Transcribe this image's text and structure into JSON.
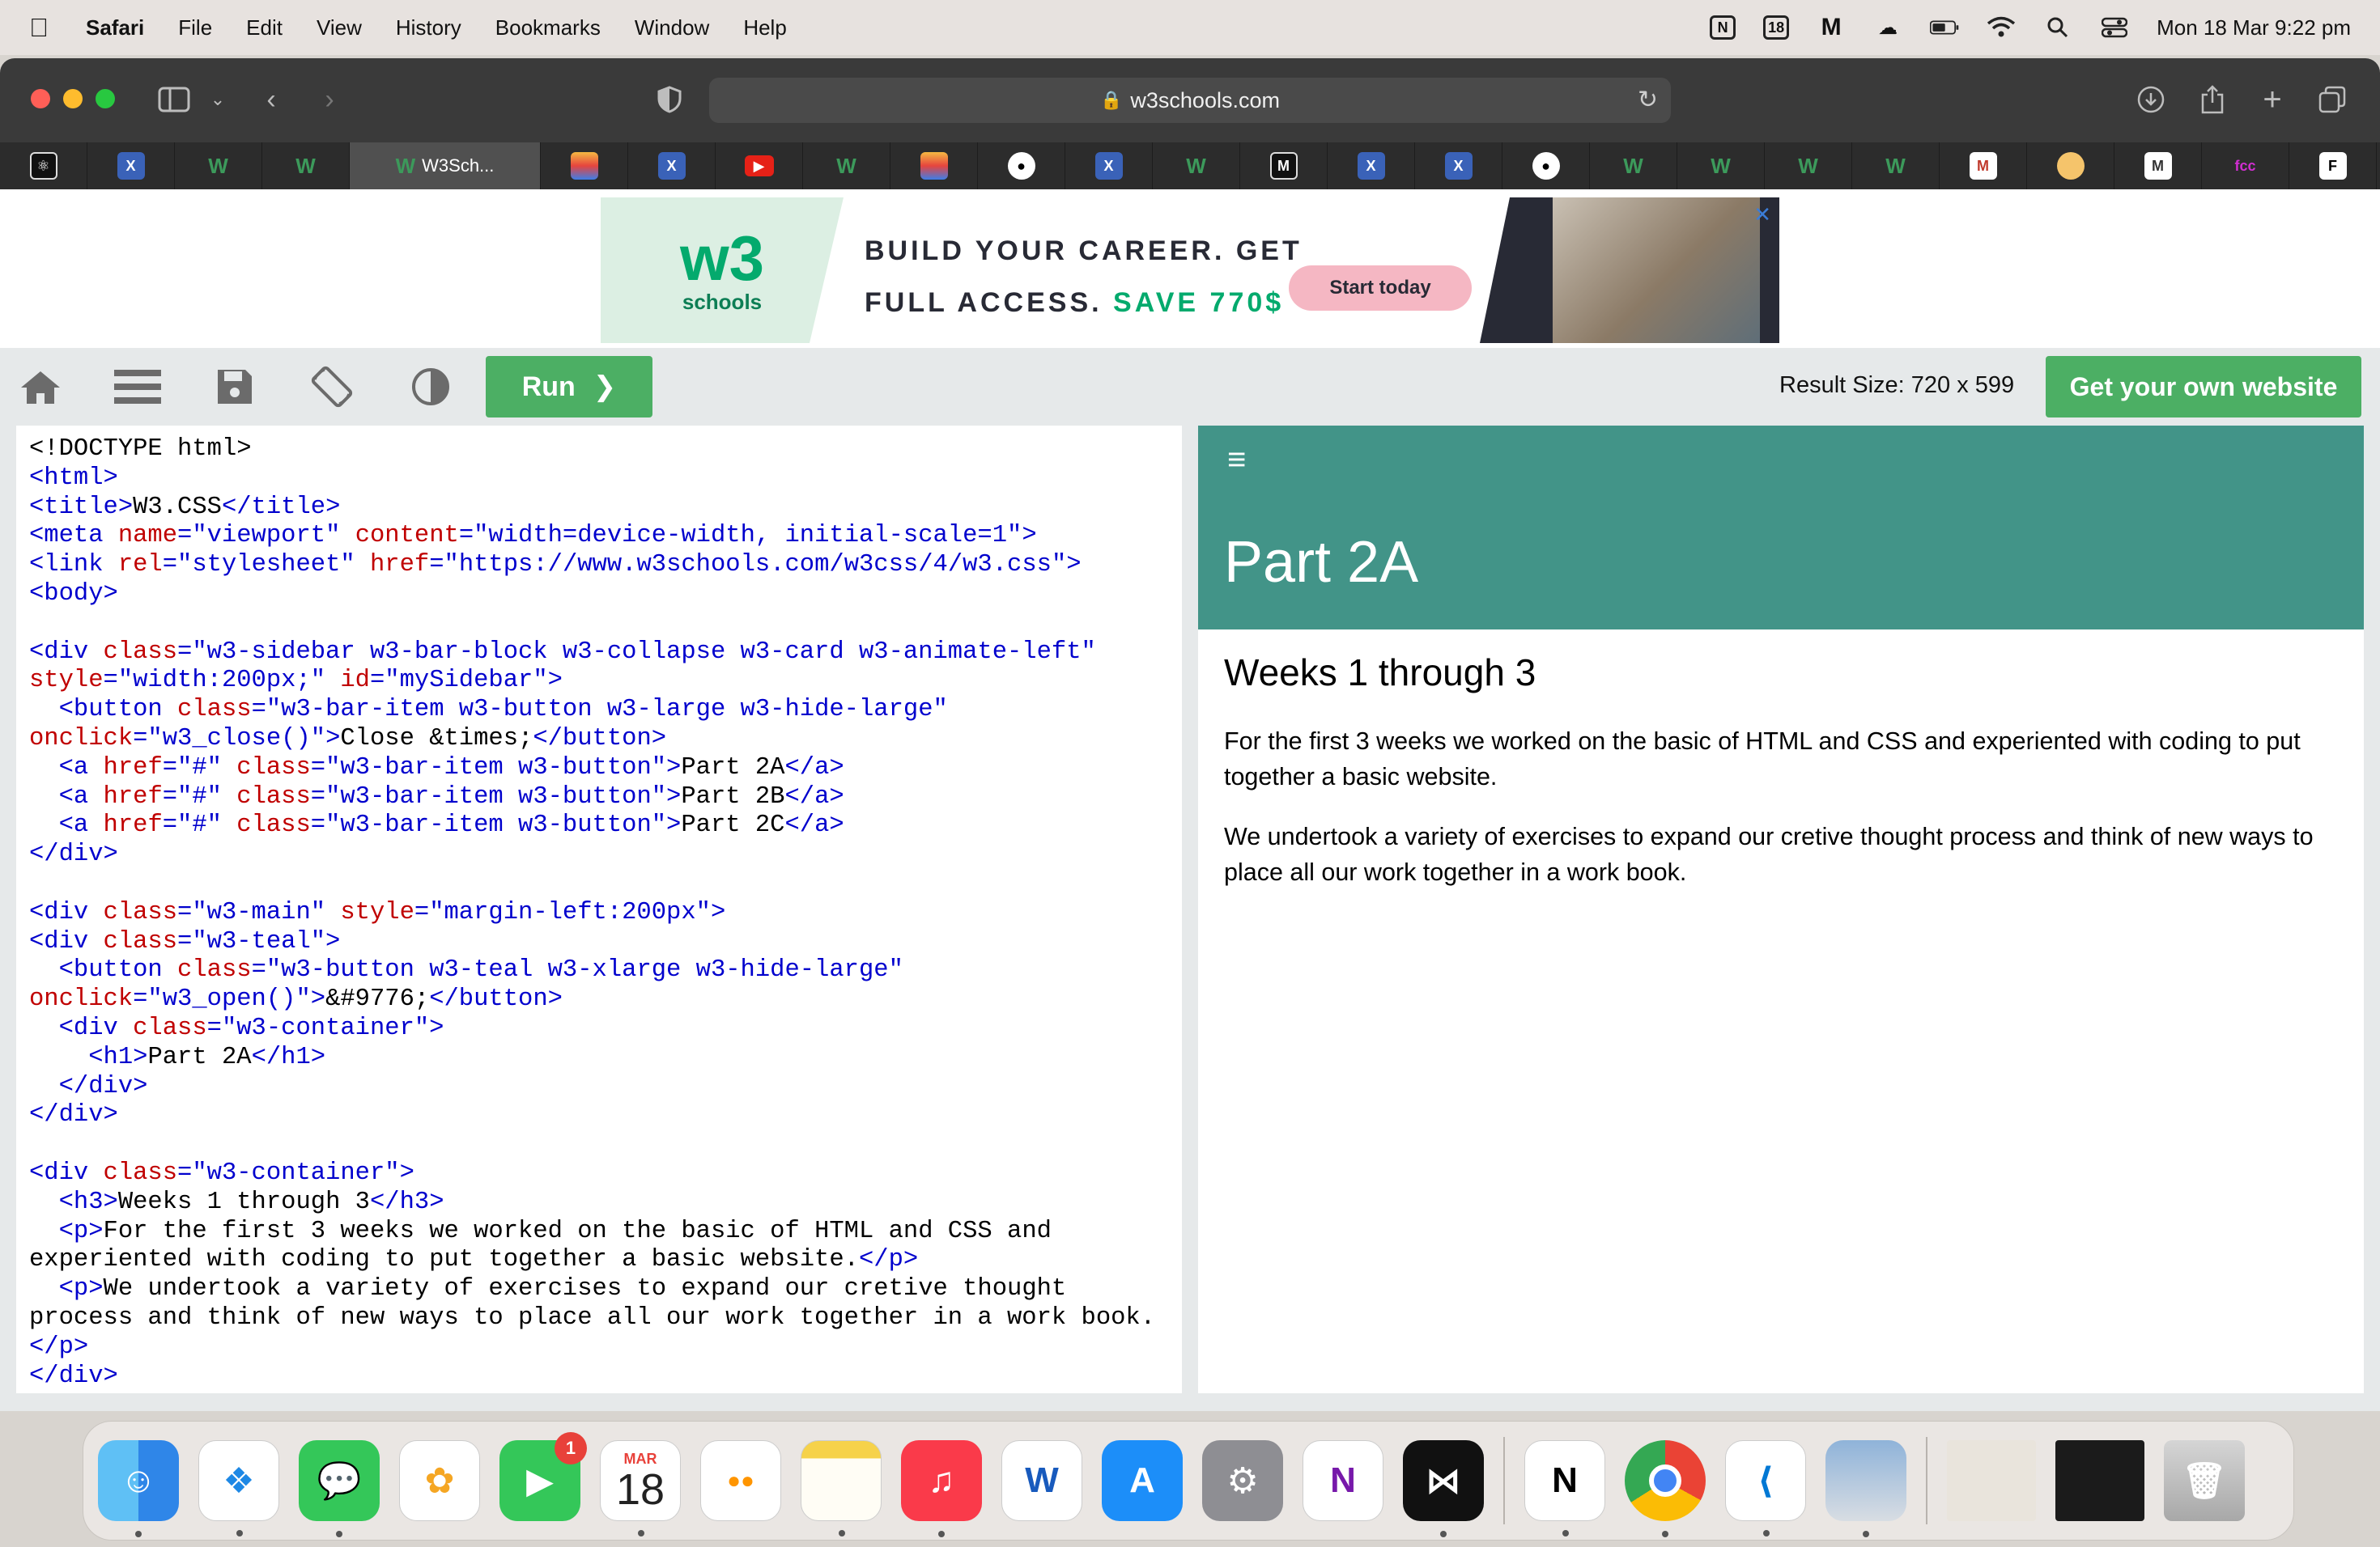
{
  "menubar": {
    "app_name": "Safari",
    "menus": [
      "File",
      "Edit",
      "View",
      "History",
      "Bookmarks",
      "Window",
      "Help"
    ],
    "status_badge_18": "18",
    "datetime": "Mon 18 Mar  9:22 pm"
  },
  "browser": {
    "url": "w3schools.com",
    "active_tab_label": "W3Sch...",
    "tab_icons": [
      "atom-icon",
      "w3schools-badge-icon",
      "w3-icon",
      "w3-icon",
      "w3-icon-active",
      "photos-icon",
      "w3schools-badge-icon",
      "youtube-icon",
      "w3-icon",
      "photos-icon",
      "github-icon",
      "w3schools-badge-icon",
      "w3-icon",
      "miro-icon",
      "w3schools-badge-icon",
      "w3schools-badge-icon",
      "github-icon",
      "w3-icon",
      "w3-icon",
      "w3-icon",
      "w3-icon",
      "m-icon",
      "tidy-icon",
      "m-icon",
      "fcc-icon",
      "f-icon"
    ]
  },
  "ad": {
    "logo_w3": "w3",
    "logo_schools": "schools",
    "headline_line1": "BUILD YOUR CAREER. GET",
    "headline_line2_prefix": "FULL ACCESS.",
    "headline_line2_save": "SAVE 770$",
    "cta": "Start today"
  },
  "tryit": {
    "run_label": "Run",
    "result_size": "Result Size: 720 x 599",
    "own_website": "Get your own website"
  },
  "code_lines": [
    [
      [
        "t",
        "<!DOCTYPE html>"
      ]
    ],
    [
      [
        "g",
        "<html>"
      ]
    ],
    [
      [
        "g",
        "<title>"
      ],
      [
        "t",
        "W3.CSS"
      ],
      [
        "g",
        "</title>"
      ]
    ],
    [
      [
        "g",
        "<meta "
      ],
      [
        "a",
        "name"
      ],
      [
        "g",
        "=\"viewport\" "
      ],
      [
        "a",
        "content"
      ],
      [
        "g",
        "=\"width=device-width, initial-scale=1\">"
      ]
    ],
    [
      [
        "g",
        "<link "
      ],
      [
        "a",
        "rel"
      ],
      [
        "g",
        "=\"stylesheet\" "
      ],
      [
        "a",
        "href"
      ],
      [
        "g",
        "=\"https://www.w3schools.com/w3css/4/w3.css\">"
      ]
    ],
    [
      [
        "g",
        "<body>"
      ]
    ],
    [
      [
        "t",
        ""
      ]
    ],
    [
      [
        "g",
        "<div "
      ],
      [
        "a",
        "class"
      ],
      [
        "g",
        "=\"w3-sidebar w3-bar-block w3-collapse w3-card w3-animate-left\""
      ]
    ],
    [
      [
        "a",
        "style"
      ],
      [
        "g",
        "=\"width:200px;\" "
      ],
      [
        "a",
        "id"
      ],
      [
        "g",
        "=\"mySidebar\">"
      ]
    ],
    [
      [
        "t",
        "  "
      ],
      [
        "g",
        "<button "
      ],
      [
        "a",
        "class"
      ],
      [
        "g",
        "=\"w3-bar-item w3-button w3-large w3-hide-large\""
      ]
    ],
    [
      [
        "a",
        "onclick"
      ],
      [
        "g",
        "=\"w3_close()\">"
      ],
      [
        "t",
        "Close &times;"
      ],
      [
        "g",
        "</button>"
      ]
    ],
    [
      [
        "t",
        "  "
      ],
      [
        "g",
        "<a "
      ],
      [
        "a",
        "href"
      ],
      [
        "g",
        "=\"#\" "
      ],
      [
        "a",
        "class"
      ],
      [
        "g",
        "=\"w3-bar-item w3-button\">"
      ],
      [
        "t",
        "Part 2A"
      ],
      [
        "g",
        "</a>"
      ]
    ],
    [
      [
        "t",
        "  "
      ],
      [
        "g",
        "<a "
      ],
      [
        "a",
        "href"
      ],
      [
        "g",
        "=\"#\" "
      ],
      [
        "a",
        "class"
      ],
      [
        "g",
        "=\"w3-bar-item w3-button\">"
      ],
      [
        "t",
        "Part 2B"
      ],
      [
        "g",
        "</a>"
      ]
    ],
    [
      [
        "t",
        "  "
      ],
      [
        "g",
        "<a "
      ],
      [
        "a",
        "href"
      ],
      [
        "g",
        "=\"#\" "
      ],
      [
        "a",
        "class"
      ],
      [
        "g",
        "=\"w3-bar-item w3-button\">"
      ],
      [
        "t",
        "Part 2C"
      ],
      [
        "g",
        "</a>"
      ]
    ],
    [
      [
        "g",
        "</div>"
      ]
    ],
    [
      [
        "t",
        ""
      ]
    ],
    [
      [
        "g",
        "<div "
      ],
      [
        "a",
        "class"
      ],
      [
        "g",
        "=\"w3-main\" "
      ],
      [
        "a",
        "style"
      ],
      [
        "g",
        "=\"margin-left:200px\">"
      ]
    ],
    [
      [
        "g",
        "<div "
      ],
      [
        "a",
        "class"
      ],
      [
        "g",
        "=\"w3-teal\">"
      ]
    ],
    [
      [
        "t",
        "  "
      ],
      [
        "g",
        "<button "
      ],
      [
        "a",
        "class"
      ],
      [
        "g",
        "=\"w3-button w3-teal w3-xlarge w3-hide-large\""
      ]
    ],
    [
      [
        "a",
        "onclick"
      ],
      [
        "g",
        "=\"w3_open()\">"
      ],
      [
        "t",
        "&#9776;"
      ],
      [
        "g",
        "</button>"
      ]
    ],
    [
      [
        "t",
        "  "
      ],
      [
        "g",
        "<div "
      ],
      [
        "a",
        "class"
      ],
      [
        "g",
        "=\"w3-container\">"
      ]
    ],
    [
      [
        "t",
        "    "
      ],
      [
        "g",
        "<h1>"
      ],
      [
        "t",
        "Part 2A"
      ],
      [
        "g",
        "</h1>"
      ]
    ],
    [
      [
        "t",
        "  "
      ],
      [
        "g",
        "</div>"
      ]
    ],
    [
      [
        "g",
        "</div>"
      ]
    ],
    [
      [
        "t",
        ""
      ]
    ],
    [
      [
        "g",
        "<div "
      ],
      [
        "a",
        "class"
      ],
      [
        "g",
        "=\"w3-container\">"
      ]
    ],
    [
      [
        "t",
        "  "
      ],
      [
        "g",
        "<h3>"
      ],
      [
        "t",
        "Weeks 1 through 3"
      ],
      [
        "g",
        "</h3>"
      ]
    ],
    [
      [
        "t",
        "  "
      ],
      [
        "g",
        "<p>"
      ],
      [
        "t",
        "For the first 3 weeks we worked on the basic of HTML and CSS and"
      ]
    ],
    [
      [
        "t",
        "experiented with coding to put together a basic website."
      ],
      [
        "g",
        "</p>"
      ]
    ],
    [
      [
        "t",
        "  "
      ],
      [
        "g",
        "<p>"
      ],
      [
        "t",
        "We undertook a variety of exercises to expand our cretive thought"
      ]
    ],
    [
      [
        "t",
        "process and think of new ways to place all our work together in a work book."
      ]
    ],
    [
      [
        "g",
        "</p>"
      ]
    ],
    [
      [
        "g",
        "</div>"
      ]
    ]
  ],
  "result": {
    "menu_glyph": "≡",
    "h1": "Part 2A",
    "h3": "Weeks 1 through 3",
    "p1": "For the first 3 weeks we worked on the basic of HTML and CSS and experiented with coding to put together a basic website.",
    "p2": "We undertook a variety of exercises to expand our cretive thought process and think of new ways to place all our work together in a work book."
  },
  "dock": {
    "calendar_month": "MAR",
    "calendar_day": "18",
    "facetime_badge": "1",
    "apps": [
      "finder",
      "safari",
      "messages",
      "photos",
      "facetime",
      "calendar",
      "reminders",
      "notes",
      "music",
      "word",
      "app-store",
      "system-settings",
      "onenote",
      "tidy",
      "notion",
      "chrome",
      "vscode",
      "preview",
      "recent-screenshot",
      "recent-terminal",
      "trash"
    ]
  }
}
